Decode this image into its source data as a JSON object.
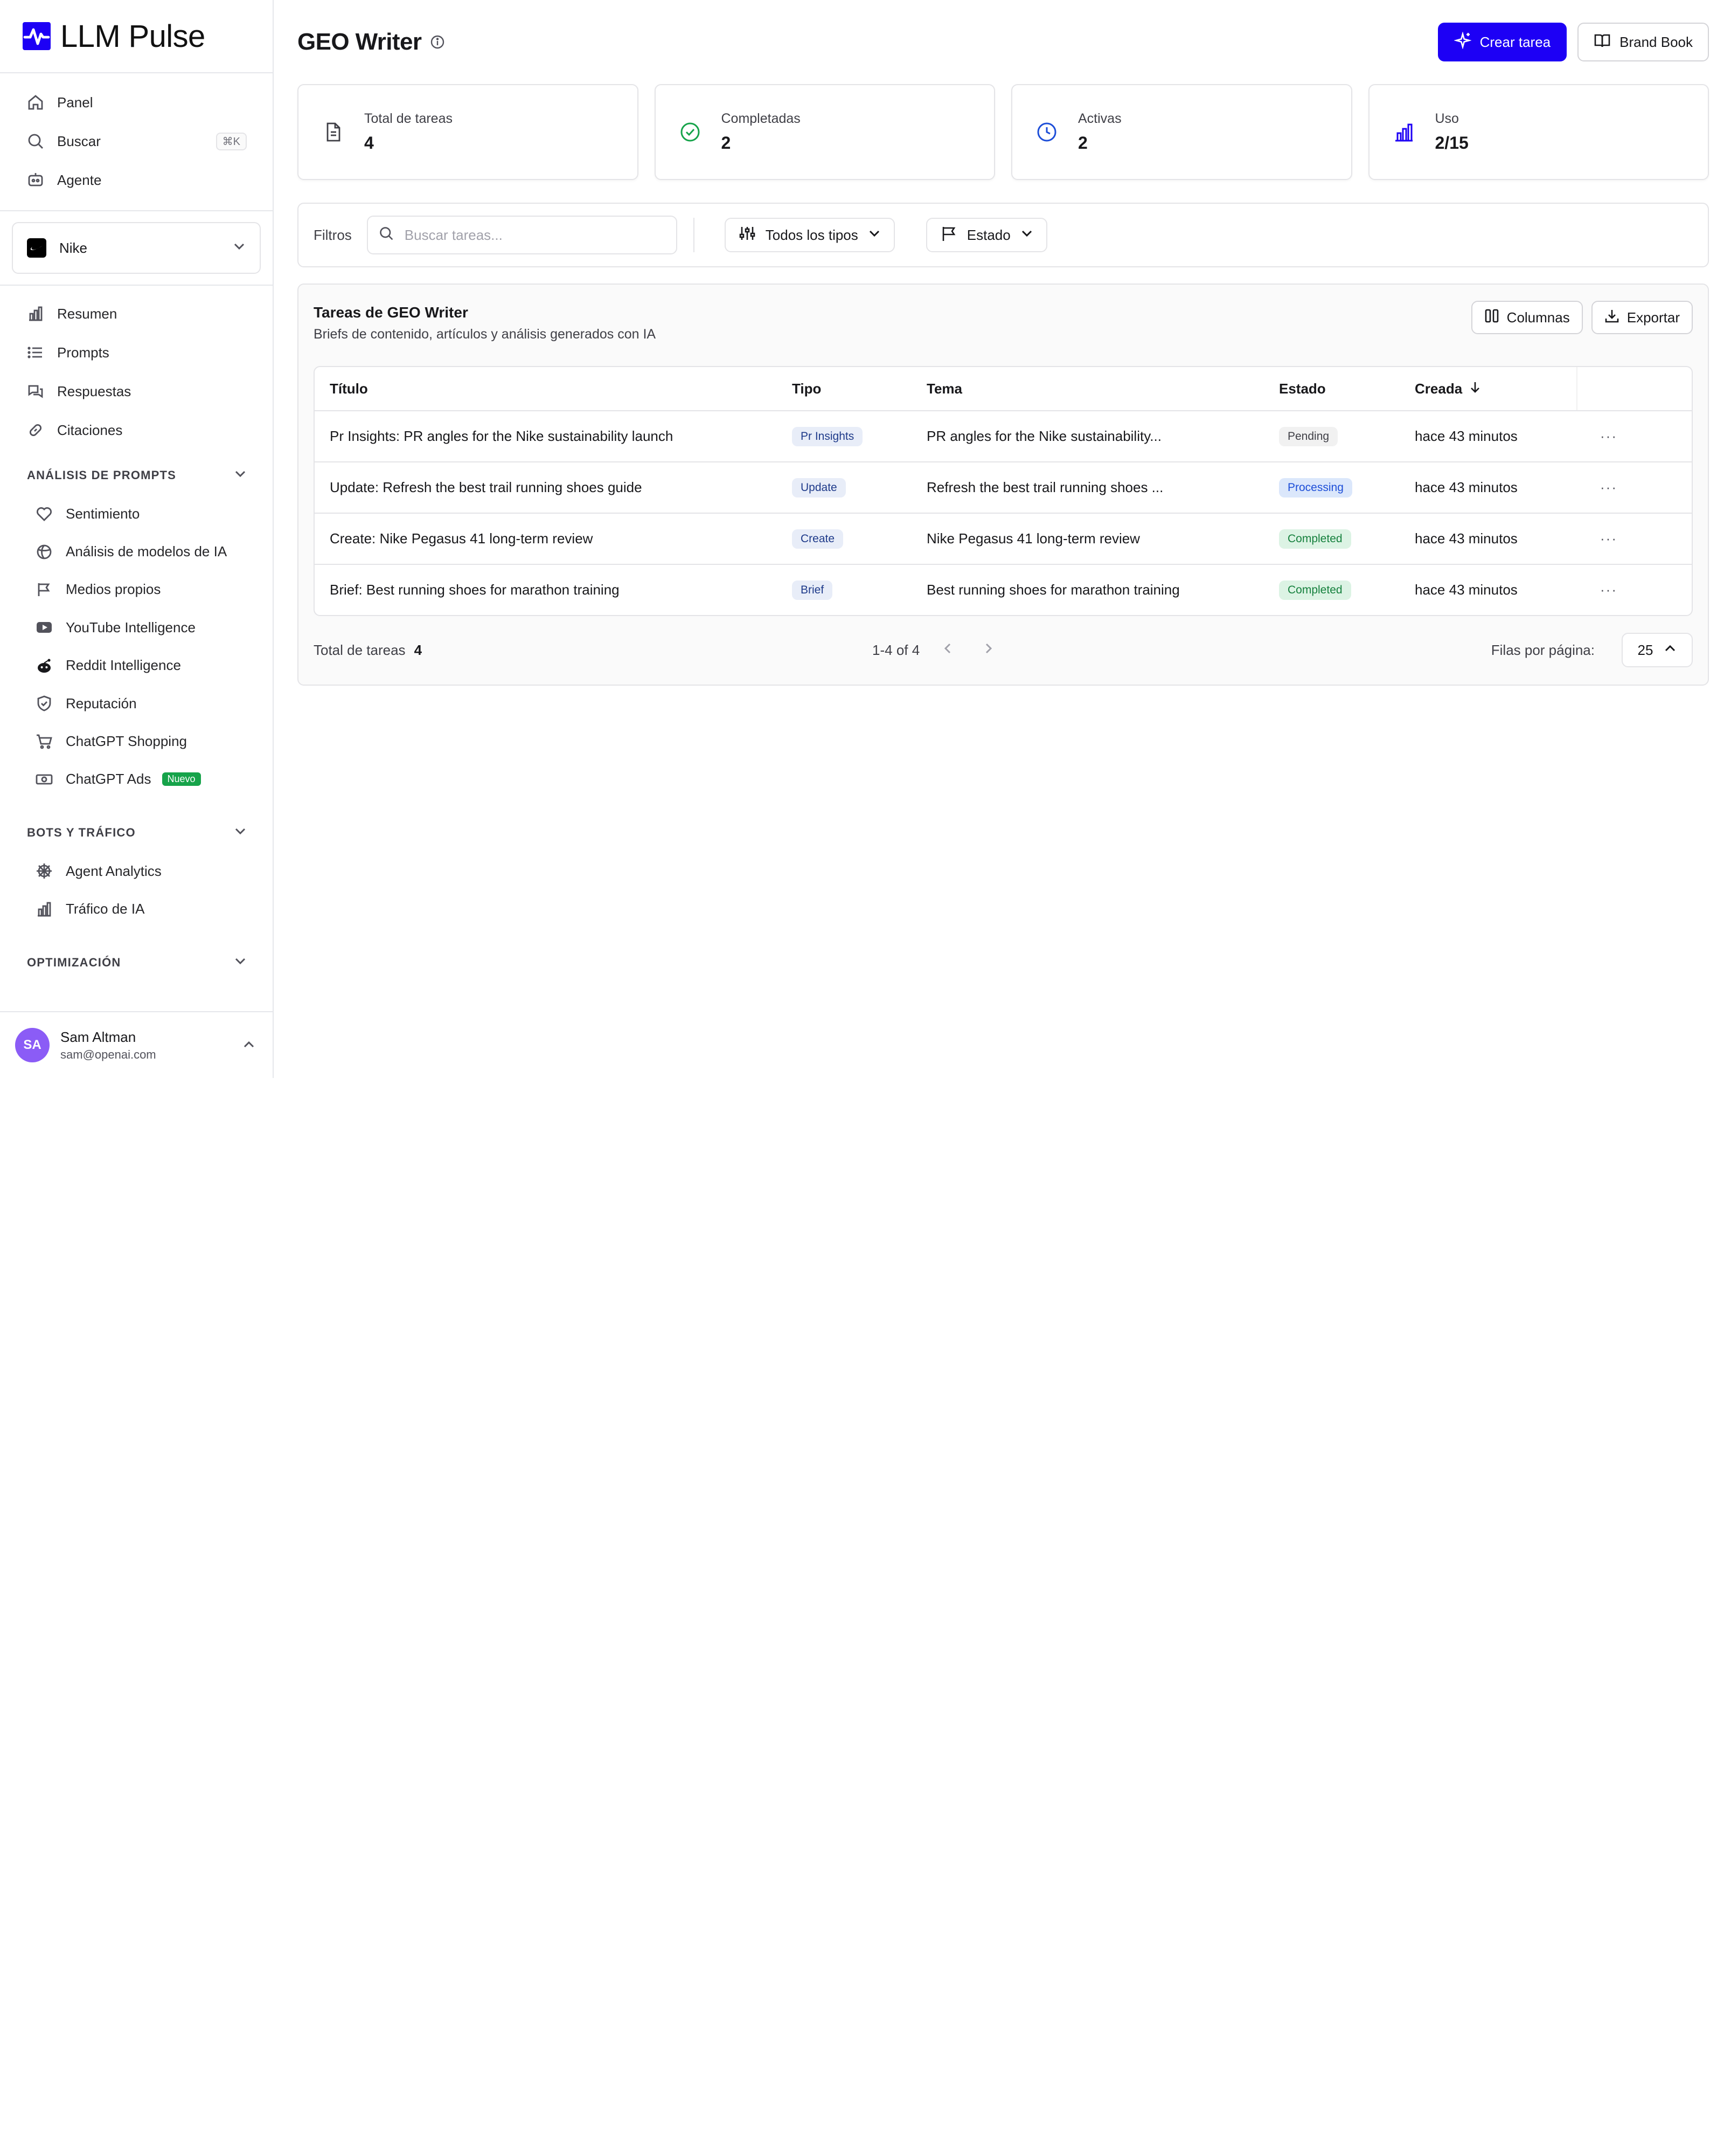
{
  "brand": {
    "name": "LLM Pulse",
    "accent": "#1d00f5"
  },
  "nav_top": [
    {
      "label": "Panel",
      "icon": "home-icon"
    },
    {
      "label": "Buscar",
      "icon": "search-icon",
      "shortcut": "⌘K"
    },
    {
      "label": "Agente",
      "icon": "bot-icon"
    }
  ],
  "brand_select": {
    "value": "Nike"
  },
  "nav_main": [
    {
      "label": "Resumen",
      "icon": "bar-chart-icon"
    },
    {
      "label": "Prompts",
      "icon": "list-icon"
    },
    {
      "label": "Respuestas",
      "icon": "chat-icon"
    },
    {
      "label": "Citaciones",
      "icon": "link-icon"
    }
  ],
  "sections": {
    "prompt_analysis": {
      "title": "ANÁLISIS DE PROMPTS",
      "items": [
        {
          "label": "Sentimiento",
          "icon": "heart-icon"
        },
        {
          "label": "Análisis de modelos de IA",
          "icon": "model-icon"
        },
        {
          "label": "Medios propios",
          "icon": "owned-media-icon"
        },
        {
          "label": "YouTube Intelligence",
          "icon": "youtube-icon"
        },
        {
          "label": "Reddit Intelligence",
          "icon": "reddit-icon"
        },
        {
          "label": "Reputación",
          "icon": "shield-icon"
        },
        {
          "label": "ChatGPT Shopping",
          "icon": "cart-icon"
        },
        {
          "label": "ChatGPT Ads",
          "icon": "money-icon",
          "badge": "Nuevo"
        }
      ]
    },
    "bots": {
      "title": "BOTS Y TRÁFICO",
      "items": [
        {
          "label": "Agent Analytics",
          "icon": "globe-icon"
        },
        {
          "label": "Tráfico de IA",
          "icon": "bar-chart-icon"
        }
      ]
    },
    "optimization": {
      "title": "OPTIMIZACIÓN"
    }
  },
  "user": {
    "initials": "SA",
    "name": "Sam Altman",
    "email": "sam@openai.com"
  },
  "header": {
    "title": "GEO Writer",
    "create_label": "Crear tarea",
    "brandbook_label": "Brand Book"
  },
  "stats": [
    {
      "label": "Total de tareas",
      "value": "4",
      "icon": "document-icon",
      "color": "#3f3f46"
    },
    {
      "label": "Completadas",
      "value": "2",
      "icon": "check-circle-icon",
      "color": "#16a34a"
    },
    {
      "label": "Activas",
      "value": "2",
      "icon": "clock-icon",
      "color": "#1d4ed8"
    },
    {
      "label": "Uso",
      "value": "2/15",
      "icon": "usage-chart-icon",
      "color": "#1d00f5"
    }
  ],
  "filters": {
    "label": "Filtros",
    "search_placeholder": "Buscar tareas...",
    "type_filter": "Todos los tipos",
    "status_filter": "Estado"
  },
  "tasks": {
    "title": "Tareas de GEO Writer",
    "subtitle": "Briefs de contenido, artículos y análisis generados con IA",
    "columns_label": "Columnas",
    "export_label": "Exportar",
    "headers": {
      "title": "Título",
      "type": "Tipo",
      "topic": "Tema",
      "status": "Estado",
      "created": "Creada"
    },
    "rows": [
      {
        "title": "Pr Insights: PR angles for the Nike sustainability launch",
        "type": "Pr Insights",
        "topic": "PR angles for the Nike sustainability...",
        "status": "Pending",
        "created": "hace 43 minutos"
      },
      {
        "title": "Update: Refresh the best trail running shoes guide",
        "type": "Update",
        "topic": "Refresh the best trail running shoes ...",
        "status": "Processing",
        "created": "hace 43 minutos"
      },
      {
        "title": "Create: Nike Pegasus 41 long-term review",
        "type": "Create",
        "topic": "Nike Pegasus 41 long-term review",
        "status": "Completed",
        "created": "hace 43 minutos"
      },
      {
        "title": "Brief: Best running shoes for marathon training",
        "type": "Brief",
        "topic": "Best running shoes for marathon training",
        "status": "Completed",
        "created": "hace 43 minutos"
      }
    ],
    "footer": {
      "total_label": "Total de tareas",
      "total_value": "4",
      "page_info": "1-4 of 4",
      "rows_label": "Filas por página:",
      "rows_value": "25"
    }
  }
}
